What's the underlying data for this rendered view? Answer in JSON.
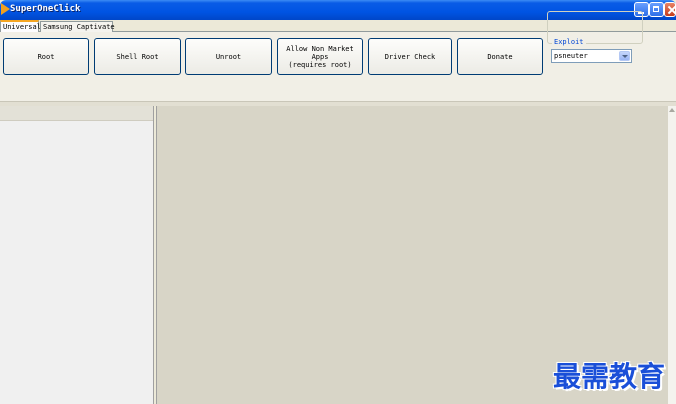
{
  "window": {
    "title": "SuperOneClick"
  },
  "tabs": [
    {
      "label": "Universal",
      "active": true
    },
    {
      "label": "Samsung Captivate",
      "active": false
    }
  ],
  "buttons": [
    {
      "label": "Root"
    },
    {
      "label": "Shell Root"
    },
    {
      "label": "Unroot"
    },
    {
      "label": "Allow Non Market\nApps\n(requires root)"
    },
    {
      "label": "Driver Check"
    },
    {
      "label": "Donate"
    }
  ],
  "exploit": {
    "legend": "Exploit",
    "selected": "psneuter"
  },
  "watermark": "最需教育",
  "colors": {
    "titlebar": "#0054e3",
    "accent": "#0046d5"
  }
}
